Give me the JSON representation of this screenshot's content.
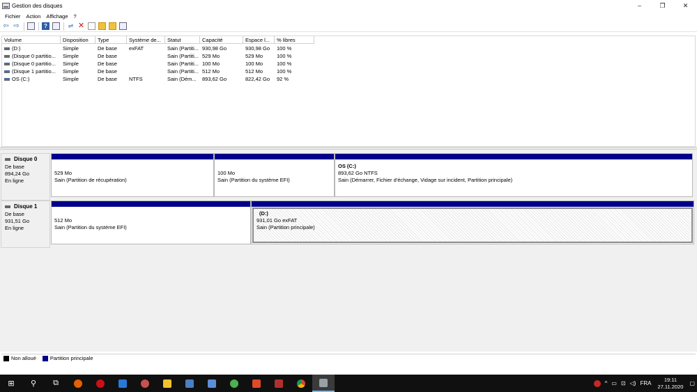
{
  "window": {
    "title": "Gestion des disques",
    "controls": {
      "minimize": "–",
      "maximize": "❐",
      "close": "✕"
    }
  },
  "menu": [
    "Fichier",
    "Action",
    "Affichage",
    "?"
  ],
  "toolbar": {
    "icons": [
      "back-arrow",
      "forward-arrow",
      "list-view",
      "help",
      "properties",
      "connect-disk",
      "delete",
      "check-doc",
      "new-doc",
      "open-folder",
      "settings"
    ]
  },
  "volume_list": {
    "columns": [
      "Volume",
      "Disposition",
      "Type",
      "Système de...",
      "Statut",
      "Capacité",
      "Espace l...",
      "% libres"
    ],
    "rows": [
      [
        "(D:)",
        "Simple",
        "De base",
        "exFAT",
        "Sain (Partiti...",
        "930,98 Go",
        "930,98 Go",
        "100 %"
      ],
      [
        "(Disque 0 partitio...",
        "Simple",
        "De base",
        "",
        "Sain (Partiti...",
        "529 Mo",
        "529 Mo",
        "100 %"
      ],
      [
        "(Disque 0 partitio...",
        "Simple",
        "De base",
        "",
        "Sain (Partiti...",
        "100 Mo",
        "100 Mo",
        "100 %"
      ],
      [
        "(Disque 1 partitio...",
        "Simple",
        "De base",
        "",
        "Sain (Partiti...",
        "512 Mo",
        "512 Mo",
        "100 %"
      ],
      [
        "OS (C:)",
        "Simple",
        "De base",
        "NTFS",
        "Sain (Dém...",
        "893,62 Go",
        "822,42 Go",
        "92 %"
      ]
    ]
  },
  "disks": [
    {
      "name": "Disque 0",
      "type": "De base",
      "size": "894,24 Go",
      "status": "En ligne",
      "partitions": [
        {
          "name": "",
          "size": "529 Mo",
          "status": "Sain (Partition de récupération)"
        },
        {
          "name": "",
          "size": "100 Mo",
          "status": "Sain (Partition du système EFI)"
        },
        {
          "name": "OS  (C:)",
          "size": "893,62 Go NTFS",
          "status": "Sain (Démarrer, Fichier d'échange, Vidage sur incident, Partition principale)"
        }
      ]
    },
    {
      "name": "Disque 1",
      "type": "De base",
      "size": "931,51 Go",
      "status": "En ligne",
      "partitions": [
        {
          "name": "",
          "size": "512 Mo",
          "status": "Sain (Partition du système EFI)"
        },
        {
          "name": "(D:)",
          "size": "931,01 Go exFAT",
          "status": "Sain (Partition principale)"
        }
      ]
    }
  ],
  "legend": [
    {
      "label": "Non alloué",
      "color": "#000000"
    },
    {
      "label": "Partition principale",
      "color": "#00008b"
    }
  ],
  "taskbar": {
    "apps": [
      "windows-start",
      "search",
      "task-view",
      "firefox",
      "opera",
      "app-blue",
      "app-settings",
      "file-explorer",
      "app-photo",
      "virtualbox",
      "app-green",
      "app-red",
      "app-red2",
      "chrome",
      "disk-management"
    ],
    "language": "FRA",
    "time": "19:11",
    "date": "27.11.2020"
  },
  "colors": {
    "primary_partition": "#00008b",
    "unallocated": "#000000",
    "taskbar": "#101010"
  }
}
